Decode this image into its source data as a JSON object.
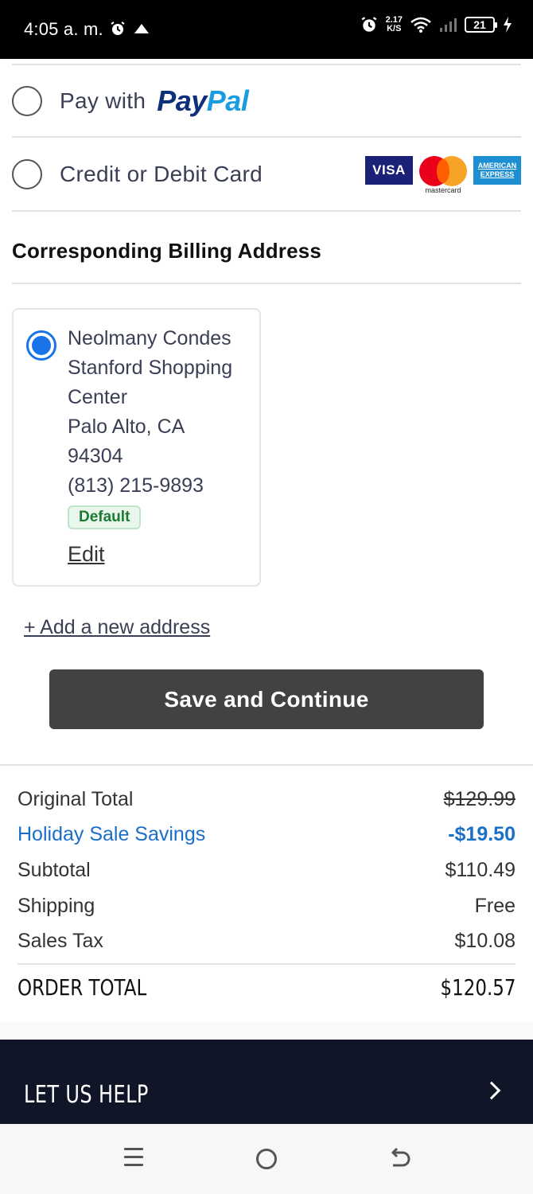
{
  "status_bar": {
    "time": "4:05 a. m.",
    "net_speed_value": "2.17",
    "net_speed_unit": "K/S",
    "battery": "21",
    "icons": [
      "alarm-icon",
      "cloud-upload-icon",
      "alarm-icon",
      "wifi-icon",
      "signal-icon",
      "battery-icon",
      "charging-icon"
    ]
  },
  "payment": {
    "paypal": {
      "prefix": "Pay with",
      "logo_a": "Pay",
      "logo_b": "Pal",
      "selected": false
    },
    "card": {
      "label": "Credit or Debit Card",
      "selected": false,
      "logos": {
        "visa": "VISA",
        "mastercard": "mastercard",
        "amex_line1": "AMERICAN",
        "amex_line2": "EXPRESS"
      }
    }
  },
  "billing": {
    "title": "Corresponding Billing Address",
    "address": {
      "name": "Neolmany Condes",
      "line1": "Stanford Shopping",
      "line2": "Center",
      "city": "Palo Alto, CA",
      "zip": "94304",
      "phone": "(813) 215-9893",
      "badge": "Default",
      "edit": "Edit",
      "selected": true
    },
    "add_new": "+ Add a new address"
  },
  "save_button": "Save and Continue",
  "summary": {
    "original_total_label": "Original Total",
    "original_total_value": "$129.99",
    "savings_label": "Holiday Sale Savings",
    "savings_value": "-$19.50",
    "subtotal_label": "Subtotal",
    "subtotal_value": "$110.49",
    "shipping_label": "Shipping",
    "shipping_value": "Free",
    "tax_label": "Sales Tax",
    "tax_value": "$10.08",
    "order_total_label": "ORDER TOTAL",
    "order_total_value": "$120.57"
  },
  "help": {
    "label": "LET US HELP"
  },
  "colors": {
    "accent_blue": "#1a73e8",
    "savings_blue": "#1a6fc9",
    "button_dark": "#424242",
    "footer_navy": "#101528"
  }
}
